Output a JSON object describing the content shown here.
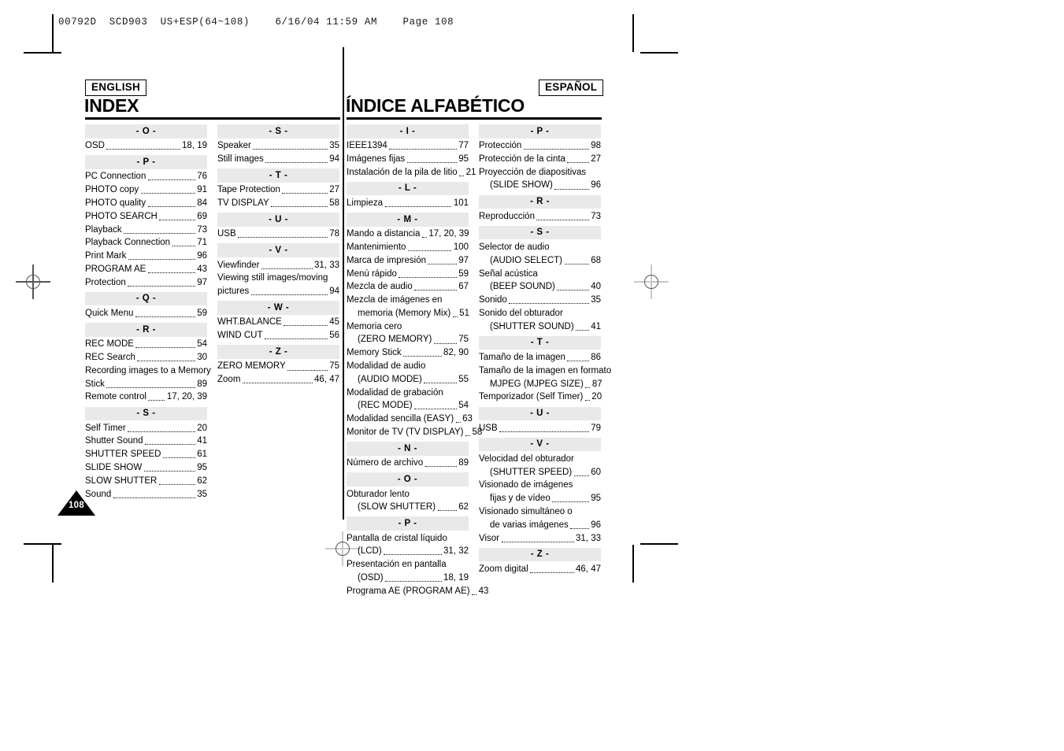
{
  "slug": "00792D  SCD903  US+ESP(64~108)    6/16/04 11:59 AM    Page 108",
  "page_number": "108",
  "english": {
    "badge": "ENGLISH",
    "title": "INDEX",
    "columns": [
      {
        "sections": [
          {
            "letter": "- O -",
            "entries": [
              {
                "name": "OSD",
                "page": "18, 19"
              }
            ]
          },
          {
            "letter": "- P -",
            "entries": [
              {
                "name": "PC Connection",
                "page": "76"
              },
              {
                "name": "PHOTO copy",
                "page": "91"
              },
              {
                "name": "PHOTO quality",
                "page": "84"
              },
              {
                "name": "PHOTO SEARCH",
                "page": "69"
              },
              {
                "name": "Playback",
                "page": "73"
              },
              {
                "name": "Playback Connection",
                "page": "71"
              },
              {
                "name": "Print Mark",
                "page": "96"
              },
              {
                "name": "PROGRAM AE",
                "page": "43"
              },
              {
                "name": "Protection",
                "page": "97"
              }
            ]
          },
          {
            "letter": "- Q -",
            "entries": [
              {
                "name": "Quick Menu",
                "page": "59"
              }
            ]
          },
          {
            "letter": "- R -",
            "entries": [
              {
                "name": "REC MODE",
                "page": "54"
              },
              {
                "name": "REC Search",
                "page": "30"
              },
              {
                "name": "Recording images to a Memory",
                "wrap": true
              },
              {
                "name": "Stick",
                "page": "89"
              },
              {
                "name": "Remote control",
                "page": "17, 20, 39"
              }
            ]
          },
          {
            "letter": "- S -",
            "entries": [
              {
                "name": "Self Timer",
                "page": "20"
              },
              {
                "name": "Shutter Sound",
                "page": "41"
              },
              {
                "name": "SHUTTER SPEED",
                "page": "61"
              },
              {
                "name": "SLIDE SHOW",
                "page": "95"
              },
              {
                "name": "SLOW SHUTTER",
                "page": "62"
              },
              {
                "name": "Sound",
                "page": "35"
              }
            ]
          }
        ]
      },
      {
        "sections": [
          {
            "letter": "- S -",
            "entries": [
              {
                "name": "Speaker",
                "page": "35"
              },
              {
                "name": "Still images",
                "page": "94"
              }
            ]
          },
          {
            "letter": "- T -",
            "entries": [
              {
                "name": "Tape Protection",
                "page": "27"
              },
              {
                "name": "TV DISPLAY",
                "page": "58"
              }
            ]
          },
          {
            "letter": "- U -",
            "entries": [
              {
                "name": "USB",
                "page": "78"
              }
            ]
          },
          {
            "letter": "- V -",
            "entries": [
              {
                "name": "Viewfinder",
                "page": "31, 33"
              },
              {
                "name": "Viewing still images/moving",
                "wrap": true
              },
              {
                "name": "pictures",
                "page": "94"
              }
            ]
          },
          {
            "letter": "- W -",
            "entries": [
              {
                "name": "WHT.BALANCE",
                "page": "45"
              },
              {
                "name": "WIND CUT",
                "page": "56"
              }
            ]
          },
          {
            "letter": "- Z -",
            "entries": [
              {
                "name": "ZERO MEMORY",
                "page": "75"
              },
              {
                "name": "Zoom",
                "page": "46, 47"
              }
            ]
          }
        ]
      }
    ]
  },
  "spanish": {
    "badge": "ESPAÑOL",
    "title": "ÍNDICE ALFABÉTICO",
    "columns": [
      {
        "sections": [
          {
            "letter": "- I -",
            "entries": [
              {
                "name": "IEEE1394",
                "page": "77"
              },
              {
                "name": "Imágenes fijas",
                "page": "95"
              },
              {
                "name": "Instalación de la pila de litio",
                "page": "21"
              }
            ]
          },
          {
            "letter": "- L -",
            "entries": [
              {
                "name": "Limpieza",
                "page": "101"
              }
            ]
          },
          {
            "letter": "- M -",
            "entries": [
              {
                "name": "Mando a distancia",
                "page": "17, 20, 39"
              },
              {
                "name": "Mantenimiento",
                "page": "100"
              },
              {
                "name": "Marca de impresión",
                "page": "97"
              },
              {
                "name": "Menú rápido",
                "page": "59"
              },
              {
                "name": "Mezcla de audio",
                "page": "67"
              },
              {
                "name": "Mezcla de imágenes en",
                "wrap": true
              },
              {
                "name": "memoria (Memory Mix)",
                "page": "51",
                "indent": true
              },
              {
                "name": "Memoria cero",
                "wrap": true
              },
              {
                "name": "(ZERO MEMORY)",
                "page": "75",
                "indent": true
              },
              {
                "name": "Memory Stick",
                "page": "82, 90"
              },
              {
                "name": "Modalidad de audio",
                "wrap": true
              },
              {
                "name": "(AUDIO MODE)",
                "page": "55",
                "indent": true
              },
              {
                "name": "Modalidad de grabación",
                "wrap": true
              },
              {
                "name": "(REC MODE)",
                "page": "54",
                "indent": true
              },
              {
                "name": "Modalidad sencilla (EASY)",
                "page": "63"
              },
              {
                "name": "Monitor de TV (TV DISPLAY)",
                "page": "58"
              }
            ]
          },
          {
            "letter": "- N -",
            "entries": [
              {
                "name": "Número de archivo",
                "page": "89"
              }
            ]
          },
          {
            "letter": "- O -",
            "entries": [
              {
                "name": "Obturador lento",
                "wrap": true
              },
              {
                "name": "(SLOW SHUTTER)",
                "page": "62",
                "indent": true
              }
            ]
          },
          {
            "letter": "- P -",
            "entries": [
              {
                "name": "Pantalla de cristal líquido",
                "wrap": true
              },
              {
                "name": "(LCD)",
                "page": "31, 32",
                "indent": true
              },
              {
                "name": "Presentación en pantalla",
                "wrap": true
              },
              {
                "name": "(OSD)",
                "page": "18, 19",
                "indent": true
              },
              {
                "name": "Programa AE (PROGRAM AE)",
                "page": "43"
              }
            ]
          }
        ]
      },
      {
        "sections": [
          {
            "letter": "- P -",
            "entries": [
              {
                "name": "Protección",
                "page": "98"
              },
              {
                "name": "Protección de la cinta",
                "page": "27"
              },
              {
                "name": "Proyección de diapositivas",
                "wrap": true
              },
              {
                "name": "(SLIDE SHOW)",
                "page": "96",
                "indent": true
              }
            ]
          },
          {
            "letter": "- R -",
            "entries": [
              {
                "name": "Reproducción",
                "page": "73"
              }
            ]
          },
          {
            "letter": "- S -",
            "entries": [
              {
                "name": "Selector de audio",
                "wrap": true
              },
              {
                "name": "(AUDIO SELECT)",
                "page": "68",
                "indent": true
              },
              {
                "name": "Señal acústica",
                "wrap": true
              },
              {
                "name": "(BEEP SOUND)",
                "page": "40",
                "indent": true
              },
              {
                "name": "Sonido",
                "page": "35"
              },
              {
                "name": "Sonido del obturador",
                "wrap": true
              },
              {
                "name": "(SHUTTER SOUND)",
                "page": "41",
                "indent": true
              }
            ]
          },
          {
            "letter": "- T -",
            "entries": [
              {
                "name": "Tamaño de la imagen",
                "page": "86"
              },
              {
                "name": "Tamaño de la imagen en formato",
                "wrap": true
              },
              {
                "name": "MJPEG (MJPEG SIZE)",
                "page": "87",
                "indent": true
              },
              {
                "name": "Temporizador (Self Timer)",
                "page": "20"
              }
            ]
          },
          {
            "letter": "- U -",
            "entries": [
              {
                "name": "USB",
                "page": "79"
              }
            ]
          },
          {
            "letter": "- V -",
            "entries": [
              {
                "name": "Velocidad del obturador",
                "wrap": true
              },
              {
                "name": "(SHUTTER SPEED)",
                "page": "60",
                "indent": true
              },
              {
                "name": "Visionado de imágenes",
                "wrap": true
              },
              {
                "name": "fijas y de vídeo",
                "page": "95",
                "indent": true
              },
              {
                "name": "Visionado simultáneo o",
                "wrap": true
              },
              {
                "name": "de varias imágenes",
                "page": "96",
                "indent": true
              },
              {
                "name": "Visor",
                "page": "31, 33"
              }
            ]
          },
          {
            "letter": "- Z -",
            "entries": [
              {
                "name": "Zoom digital",
                "page": "46, 47"
              }
            ]
          }
        ]
      }
    ]
  }
}
